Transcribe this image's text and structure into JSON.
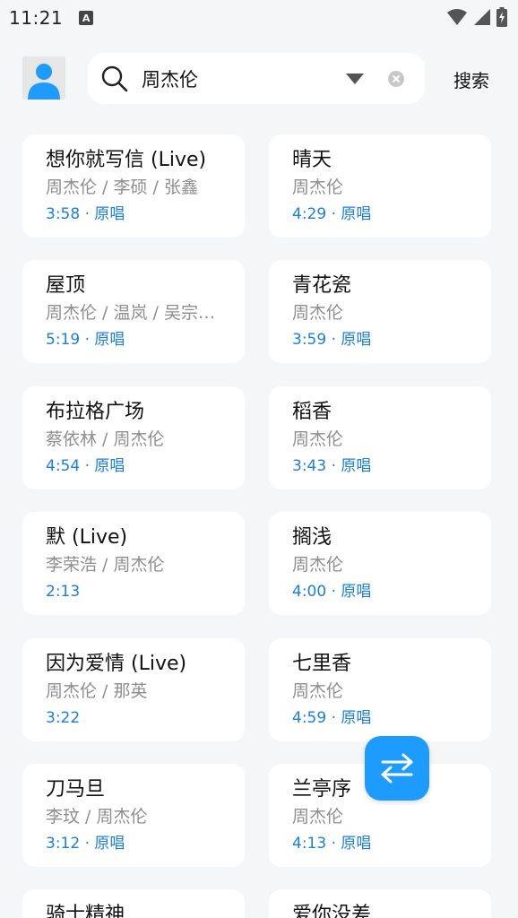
{
  "status_bar": {
    "time": "11:21",
    "notification_letter": "A"
  },
  "search": {
    "query": "周杰伦",
    "button_label": "搜索"
  },
  "colors": {
    "accent": "#1a7fe0",
    "fab": "#1e9bff",
    "background": "#f5f6f8"
  },
  "songs": [
    {
      "title": "想你就写信 (Live)",
      "artist": "周杰伦 / 李硕 / 张鑫",
      "meta": "3:58 · 原唱"
    },
    {
      "title": "晴天",
      "artist": "周杰伦",
      "meta": "4:29 · 原唱"
    },
    {
      "title": "屋顶",
      "artist": "周杰伦 / 温岚 / 吴宗…",
      "meta": "5:19 · 原唱"
    },
    {
      "title": "青花瓷",
      "artist": "周杰伦",
      "meta": "3:59 · 原唱"
    },
    {
      "title": "布拉格广场",
      "artist": "蔡依林 / 周杰伦",
      "meta": "4:54 · 原唱"
    },
    {
      "title": "稻香",
      "artist": "周杰伦",
      "meta": "3:43 · 原唱"
    },
    {
      "title": "默 (Live)",
      "artist": "李荣浩 / 周杰伦",
      "meta": "2:13"
    },
    {
      "title": "搁浅",
      "artist": "周杰伦",
      "meta": "4:00 · 原唱"
    },
    {
      "title": "因为爱情 (Live)",
      "artist": "周杰伦 / 那英",
      "meta": "3:22"
    },
    {
      "title": "七里香",
      "artist": "周杰伦",
      "meta": "4:59 · 原唱"
    },
    {
      "title": "刀马旦",
      "artist": "李玟 / 周杰伦",
      "meta": "3:12 · 原唱"
    },
    {
      "title": "兰亭序",
      "artist": "周杰伦",
      "meta": "4:13 · 原唱"
    },
    {
      "title": "骑士精神",
      "artist": "",
      "meta": ""
    },
    {
      "title": "爱你没差",
      "artist": "",
      "meta": ""
    }
  ],
  "icons": {
    "avatar": "person-icon",
    "search": "search-icon",
    "dropdown": "dropdown-triangle-icon",
    "clear": "clear-icon",
    "fab": "swap-arrows-icon"
  }
}
